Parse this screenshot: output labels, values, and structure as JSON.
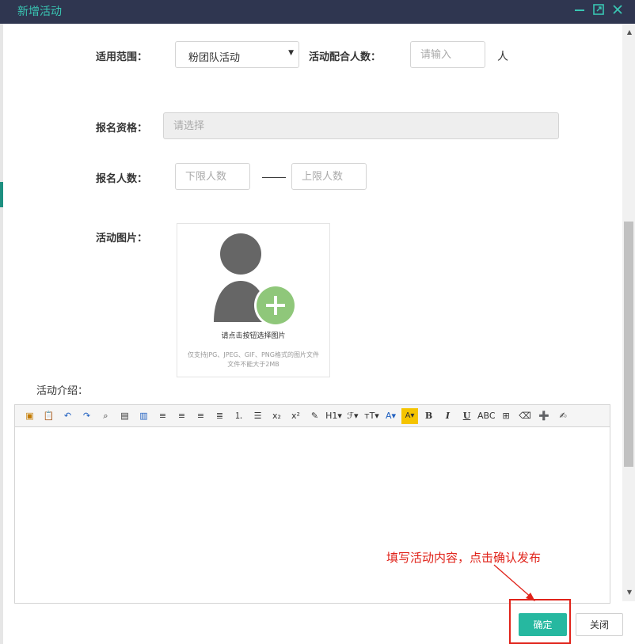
{
  "window": {
    "title": "新增活动",
    "controls": [
      "minimize-icon",
      "maximize-icon",
      "close-icon"
    ]
  },
  "form": {
    "scope_label": "适用范围：",
    "scope_value": "粉团队活动",
    "cooperation_label": "活动配合人数：",
    "cooperation_placeholder": "请输入",
    "cooperation_unit": "人",
    "qualification_label": "报名资格：",
    "qualification_placeholder": "请选择",
    "signup_count_label": "报名人数：",
    "signup_min_placeholder": "下限人数",
    "signup_max_placeholder": "上限人数",
    "image_label": "活动图片：",
    "upload_text": "请点击按钮选择图片",
    "upload_hint_1": "仅支持JPG、JPEG、GIF、PNG格式的图片文件",
    "upload_hint_2": "文件不能大于2MB",
    "intro_label": "活动介绍："
  },
  "toolbar": {
    "items": [
      {
        "name": "insert-image-icon",
        "glyph": "▣"
      },
      {
        "name": "paste-icon",
        "glyph": "📋"
      },
      {
        "name": "undo-icon",
        "glyph": "↶"
      },
      {
        "name": "redo-icon",
        "glyph": "↷"
      },
      {
        "name": "preview-icon",
        "glyph": "⌕"
      },
      {
        "name": "paste-text-icon",
        "glyph": "▤"
      },
      {
        "name": "paste-word-icon",
        "glyph": "▥"
      },
      {
        "name": "align-left-icon",
        "glyph": "≡"
      },
      {
        "name": "align-center-icon",
        "glyph": "≡"
      },
      {
        "name": "align-right-icon",
        "glyph": "≡"
      },
      {
        "name": "align-justify-icon",
        "glyph": "≣"
      },
      {
        "name": "ordered-list-icon",
        "glyph": "⒈"
      },
      {
        "name": "unordered-list-icon",
        "glyph": "☰"
      },
      {
        "name": "subscript-icon",
        "glyph": "x₂"
      },
      {
        "name": "superscript-icon",
        "glyph": "x²"
      },
      {
        "name": "clear-format-icon",
        "glyph": "✎"
      },
      {
        "name": "heading-icon",
        "glyph": "H1▾"
      },
      {
        "name": "font-family-icon",
        "glyph": "ℱ▾"
      },
      {
        "name": "font-size-icon",
        "glyph": "тT▾"
      },
      {
        "name": "font-color-icon",
        "glyph": "A▾"
      },
      {
        "name": "highlight-icon",
        "glyph": "A▾"
      },
      {
        "name": "bold-icon",
        "glyph": "B"
      },
      {
        "name": "italic-icon",
        "glyph": "I"
      },
      {
        "name": "underline-icon",
        "glyph": "U"
      },
      {
        "name": "strikethrough-icon",
        "glyph": "ABC"
      },
      {
        "name": "table-icon",
        "glyph": "⊞"
      },
      {
        "name": "eraser-icon",
        "glyph": "⌫"
      },
      {
        "name": "insert-line-icon",
        "glyph": "➕"
      },
      {
        "name": "source-icon",
        "glyph": "✍"
      }
    ]
  },
  "annotation": {
    "text": "填写活动内容，点击确认发布"
  },
  "footer": {
    "ok_label": "确定",
    "close_label": "关闭"
  },
  "colors": {
    "titlebar": "#2f3650",
    "accent": "#39c6b3",
    "primary_button": "#26b8a0",
    "annotation": "#e0231a"
  }
}
